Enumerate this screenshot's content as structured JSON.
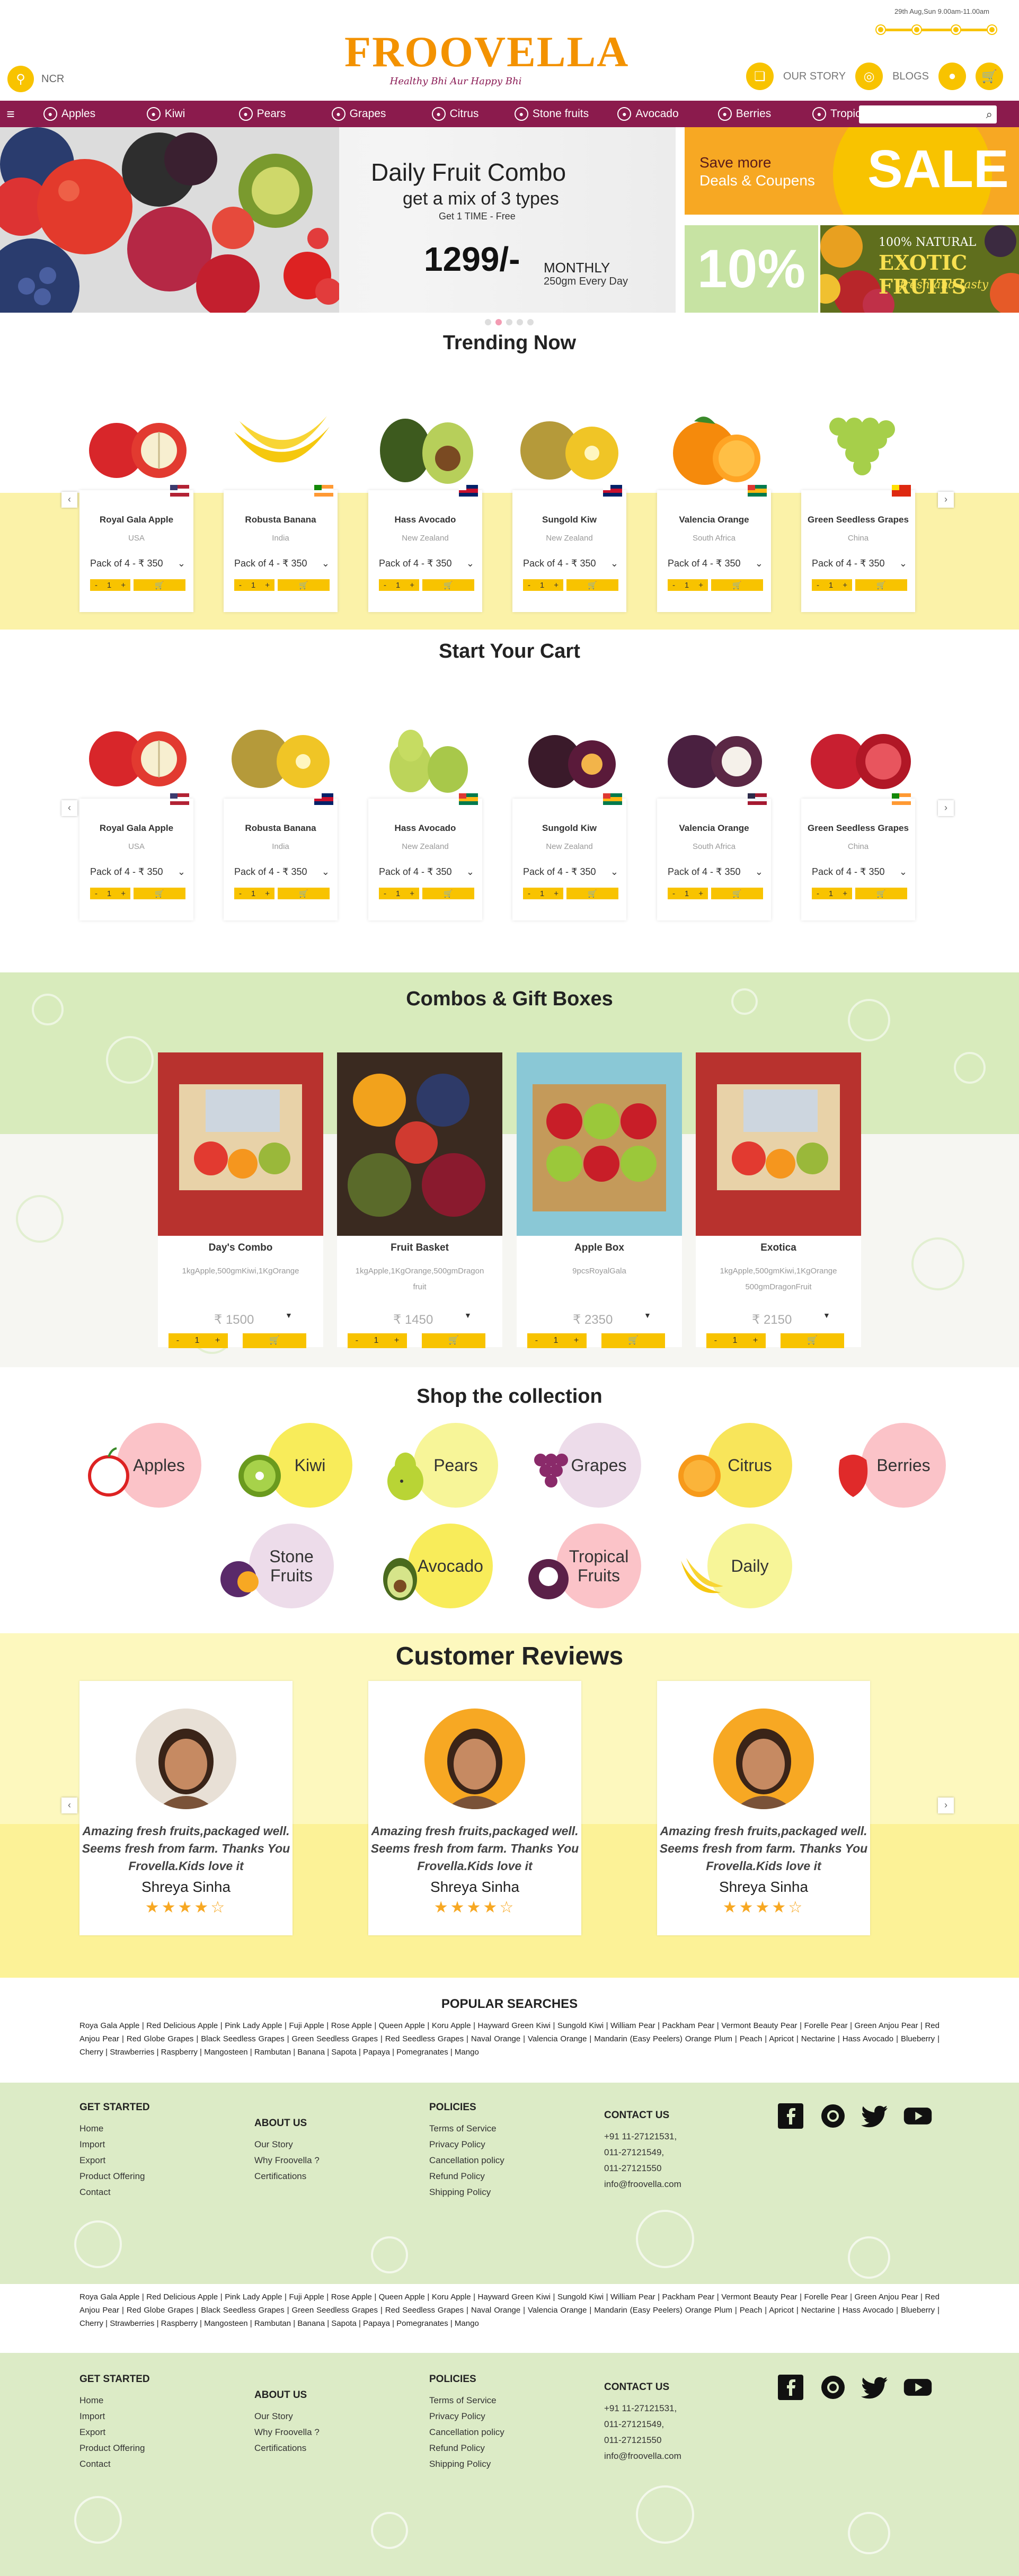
{
  "header": {
    "brand": "FROOVELLA",
    "tagline": "Healthy Bhi Aur Happy Bhi",
    "location": "NCR",
    "delivery_slot": "29th Aug,Sun 9.00am-11.00am",
    "our_story": "OUR STORY",
    "blogs": "BLOGS"
  },
  "nav": {
    "items": [
      "Apples",
      "Kiwi",
      "Pears",
      "Grapes",
      "Citrus",
      "Stone fruits",
      "Avocado",
      "Berries",
      "Tropical"
    ],
    "search_placeholder": ""
  },
  "hero": {
    "title": "Daily Fruit Combo",
    "subtitle": "get a mix of 3 types",
    "note": "Get 1 TIME - Free",
    "price": "1299/-",
    "period": "MONTHLY",
    "qty": "250gm Every Day"
  },
  "banner_sale": {
    "line1": "Save more",
    "line2": "Deals & Coupens",
    "sale": "SALE"
  },
  "banner_exotic": {
    "pct": "10%",
    "line1": "100% NATURAL",
    "line2": "EXOTIC FRUITS",
    "line3": "fresh and tasty"
  },
  "trending": {
    "title": "Trending Now",
    "products": [
      {
        "name": "Royal Gala Apple",
        "origin": "USA",
        "pack": "Pack of 4 - ₹ 350",
        "qty": "1"
      },
      {
        "name": "Robusta Banana",
        "origin": "India",
        "pack": "Pack of 4 - ₹ 350",
        "qty": "1"
      },
      {
        "name": "Hass Avocado",
        "origin": "New Zealand",
        "pack": "Pack of 4 - ₹ 350",
        "qty": "1"
      },
      {
        "name": "Sungold Kiw",
        "origin": "New Zealand",
        "pack": "Pack of 4 - ₹ 350",
        "qty": "1"
      },
      {
        "name": "Valencia Orange",
        "origin": "South Africa",
        "pack": "Pack of 4 - ₹ 350",
        "qty": "1"
      },
      {
        "name": "Green Seedless Grapes",
        "origin": "China",
        "pack": "Pack of 4 - ₹ 350",
        "qty": "1"
      }
    ]
  },
  "cart": {
    "title": "Start Your Cart",
    "products": [
      {
        "name": "Royal Gala Apple",
        "origin": "USA",
        "pack": "Pack of 4 - ₹ 350",
        "qty": "1"
      },
      {
        "name": "Robusta Banana",
        "origin": "India",
        "pack": "Pack of 4 - ₹ 350",
        "qty": "1"
      },
      {
        "name": "Hass Avocado",
        "origin": "New Zealand",
        "pack": "Pack of 4 - ₹ 350",
        "qty": "1"
      },
      {
        "name": "Sungold Kiw",
        "origin": "New Zealand",
        "pack": "Pack of 4 - ₹ 350",
        "qty": "1"
      },
      {
        "name": "Valencia Orange",
        "origin": "South Africa",
        "pack": "Pack of 4 - ₹ 350",
        "qty": "1"
      },
      {
        "name": "Green Seedless Grapes",
        "origin": "China",
        "pack": "Pack of 4 - ₹ 350",
        "qty": "1"
      }
    ]
  },
  "combos": {
    "title": "Combos & Gift Boxes",
    "items": [
      {
        "name": "Day's Combo",
        "desc": "1kgApple,500gmKiwi,1KgOrange",
        "price": "₹ 1500",
        "qty": "1"
      },
      {
        "name": "Fruit Basket",
        "desc": "1kgApple,1KgOrange,500gmDragon fruit",
        "price": "₹ 1450",
        "qty": "1"
      },
      {
        "name": "Apple Box",
        "desc": "9pcsRoyalGala",
        "price": "₹ 2350",
        "qty": "1"
      },
      {
        "name": "Exotica",
        "desc": "1kgApple,500gmKiwi,1KgOrange 500gmDragonFruit",
        "price": "₹ 2150",
        "qty": "1"
      }
    ]
  },
  "collection": {
    "title": "Shop the collection",
    "items": [
      "Apples",
      "Kiwi",
      "Pears",
      "Grapes",
      "Citrus",
      "Berries",
      "Stone Fruits",
      "Avocado",
      "Tropical Fruits",
      "Daily"
    ]
  },
  "reviews": {
    "title": "Customer Reviews",
    "items": [
      {
        "text": "Amazing fresh fruits,packaged well. Seems fresh from farm. Thanks You Frovella.Kids love it",
        "name": "Shreya Sinha",
        "stars": "★★★★☆"
      },
      {
        "text": "Amazing fresh fruits,packaged well. Seems fresh from farm. Thanks You Frovella.Kids love it",
        "name": "Shreya Sinha",
        "stars": "★★★★☆"
      },
      {
        "text": "Amazing fresh fruits,packaged well. Seems fresh from farm. Thanks You Frovella.Kids love it",
        "name": "Shreya Sinha",
        "stars": "★★★★☆"
      }
    ]
  },
  "popular": {
    "title": "POPULAR SEARCHES",
    "text": "Roya Gala Apple | Red Delicious Apple | Pink Lady Apple | Fuji Apple | Rose Apple | Queen Apple | Koru Apple | Hayward Green Kiwi | Sungold Kiwi | William Pear | Packham Pear | Vermont Beauty Pear | Forelle Pear | Green Anjou Pear | Red Anjou Pear | Red Globe Grapes | Black Seedless Grapes | Green Seedless Grapes | Red Seedless Grapes | Naval Orange | Valencia Orange | Mandarin (Easy Peelers) Orange Plum | Peach | Apricot | Nectarine | Hass Avocado | Blueberry | Cherry | Strawberries | Raspberry | Mangosteen | Rambutan | Banana | Sapota | Papaya | Pomegranates | Mango"
  },
  "footer": {
    "get_started": {
      "title": "GET STARTED",
      "links": [
        "Home",
        "Import",
        "Export",
        "Product Offering",
        "Contact"
      ]
    },
    "about": {
      "title": "ABOUT US",
      "links": [
        "Our Story",
        "Why Froovella ?",
        "Certifications"
      ]
    },
    "policies": {
      "title": "POLICIES",
      "links": [
        "Terms of Service",
        "Privacy Policy",
        "Cancellation policy",
        "Refund Policy",
        "Shipping Policy"
      ]
    },
    "contact": {
      "title": "CONTACT US",
      "lines": [
        "+91 11-27121531,",
        "011-27121549,",
        "011-27121550",
        "info@froovella.com"
      ]
    }
  },
  "colors": {
    "brand_orange": "#f39200",
    "brand_plum": "#8b1b4d",
    "accent_yellow": "#f8c300",
    "leaf_green": "#d8ebbc"
  }
}
